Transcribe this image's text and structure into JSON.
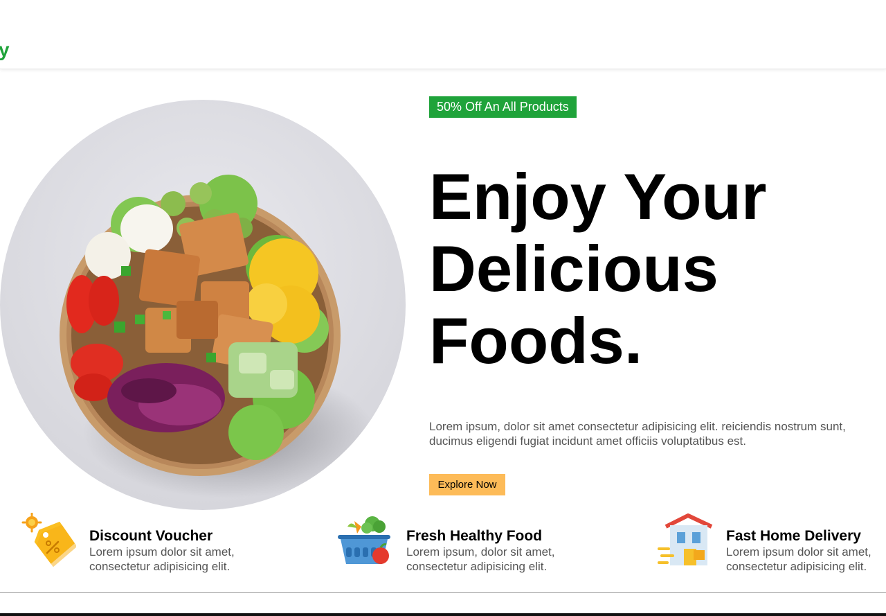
{
  "header": {
    "logo_text": "y"
  },
  "hero": {
    "image_alt_name": "salad-bowl-image",
    "promo_badge": "50% Off An All Products",
    "title_lines": [
      "Enjoy Your",
      "Delicious",
      "Foods."
    ],
    "description_lines": [
      "Lorem ipsum, dolor sit amet consectetur adipisicing elit. reiciendis nostrum sunt,",
      "ducimus eligendi fugiat incidunt amet officiis voluptatibus est."
    ],
    "cta_label": "Explore Now"
  },
  "features": [
    {
      "icon": "discount-tag-icon",
      "title": "Discount Voucher",
      "desc_lines": [
        "Lorem ipsum dolor sit amet,",
        "consectetur adipisicing elit."
      ]
    },
    {
      "icon": "grocery-basket-icon",
      "title": "Fresh Healthy Food",
      "desc_lines": [
        "Lorem ipsum, dolor sit amet,",
        "consectetur adipisicing elit."
      ]
    },
    {
      "icon": "delivery-house-icon",
      "title": "Fast Home Delivery",
      "desc_lines": [
        "Lorem ipsum dolor sit amet,",
        "consectetur adipisicing elit."
      ]
    }
  ],
  "colors": {
    "brand_green": "#1fa33a",
    "cta_yellow": "#fdbb58",
    "muted_text": "#555555"
  }
}
